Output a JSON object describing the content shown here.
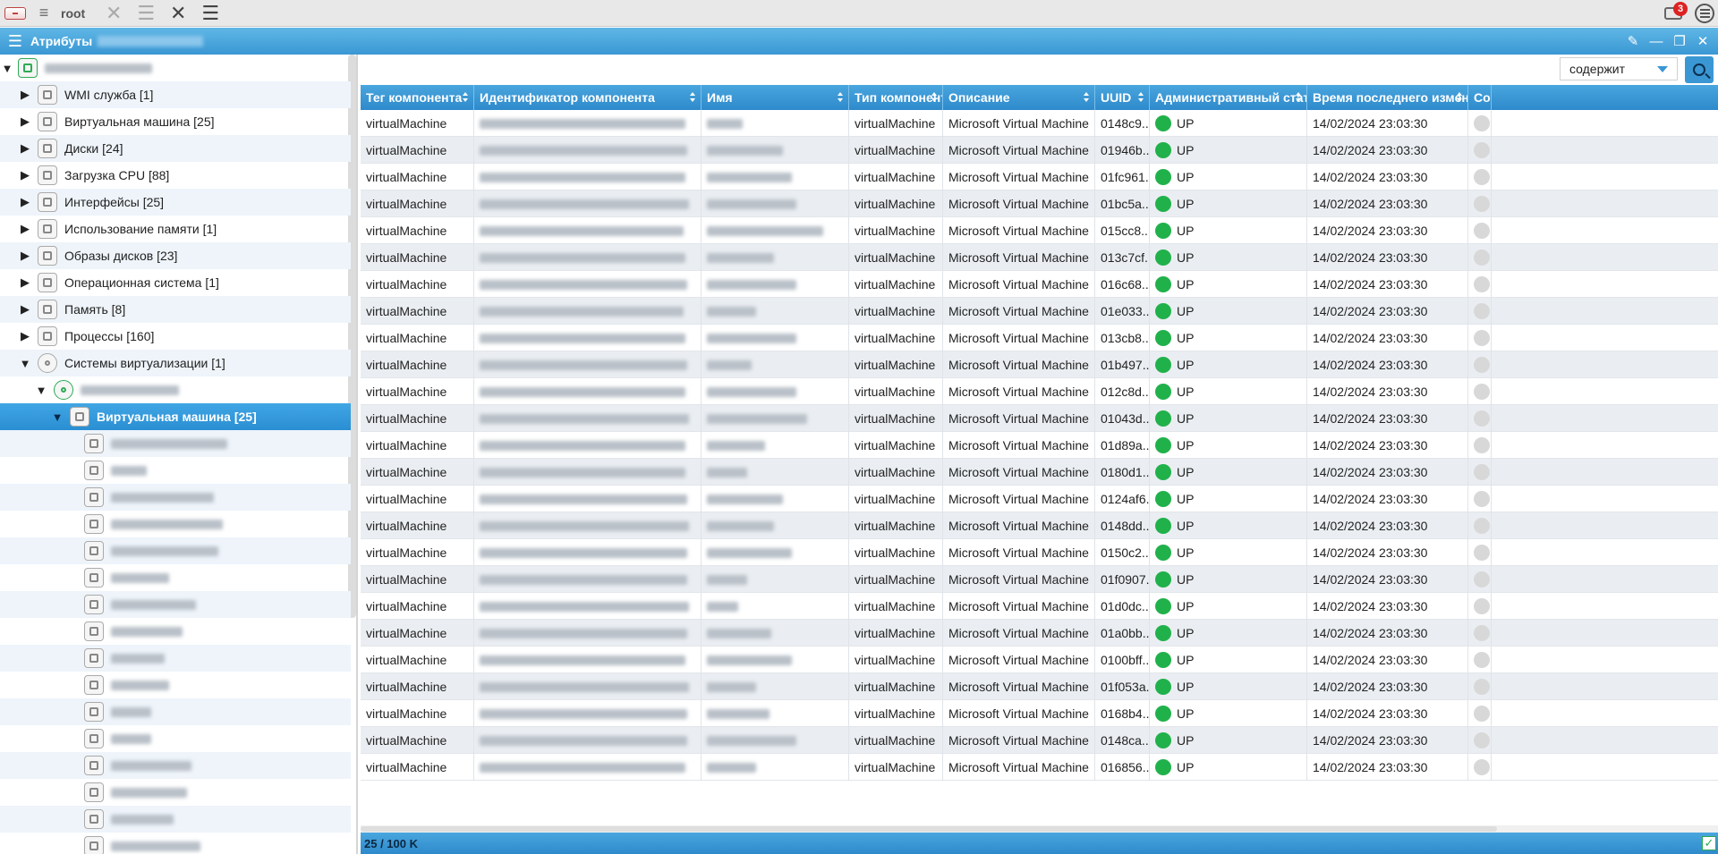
{
  "topbar": {
    "user": "root",
    "notifications_count": "3"
  },
  "window": {
    "title": "Атрибуты"
  },
  "tree": {
    "items": [
      {
        "label": "WMI служба [1]",
        "icon": "gear-icon"
      },
      {
        "label": "Виртуальная машина [25]",
        "icon": "vm-icon"
      },
      {
        "label": "Диски [24]",
        "icon": "disk-icon"
      },
      {
        "label": "Загрузка CPU [88]",
        "icon": "cpu-icon"
      },
      {
        "label": "Интерфейсы [25]",
        "icon": "network-icon"
      },
      {
        "label": "Использование памяти [1]",
        "icon": "memory-icon"
      },
      {
        "label": "Образы дисков [23]",
        "icon": "disk-image-icon"
      },
      {
        "label": "Операционная система [1]",
        "icon": "os-icon"
      },
      {
        "label": "Память [8]",
        "icon": "memory-chip-icon"
      },
      {
        "label": "Процессы [160]",
        "icon": "process-icon"
      },
      {
        "label": "Системы виртуализации [1]",
        "icon": "virtualization-icon"
      }
    ],
    "selected": {
      "label": "Виртуальная машина [25]",
      "icon": "vm-icon"
    }
  },
  "filter": {
    "mode": "содержит"
  },
  "grid": {
    "columns": [
      "Тег компонента",
      "Идентификатор компонента",
      "Имя",
      "Тип компонента",
      "Описание",
      "UUID",
      "Административный статус",
      "Время последнего изменения",
      "Сос"
    ],
    "rows": [
      {
        "tag": "virtualMachine",
        "type": "virtualMachine",
        "description": "Microsoft Virtual Machine",
        "uuid": "0148c9...",
        "status": "UP",
        "time": "14/02/2024 23:03:30"
      },
      {
        "tag": "virtualMachine",
        "type": "virtualMachine",
        "description": "Microsoft Virtual Machine",
        "uuid": "01946b...",
        "status": "UP",
        "time": "14/02/2024 23:03:30"
      },
      {
        "tag": "virtualMachine",
        "type": "virtualMachine",
        "description": "Microsoft Virtual Machine",
        "uuid": "01fc961...",
        "status": "UP",
        "time": "14/02/2024 23:03:30"
      },
      {
        "tag": "virtualMachine",
        "type": "virtualMachine",
        "description": "Microsoft Virtual Machine",
        "uuid": "01bc5a...",
        "status": "UP",
        "time": "14/02/2024 23:03:30"
      },
      {
        "tag": "virtualMachine",
        "type": "virtualMachine",
        "description": "Microsoft Virtual Machine",
        "uuid": "015cc8...",
        "status": "UP",
        "time": "14/02/2024 23:03:30"
      },
      {
        "tag": "virtualMachine",
        "type": "virtualMachine",
        "description": "Microsoft Virtual Machine",
        "uuid": "013c7cf...",
        "status": "UP",
        "time": "14/02/2024 23:03:30"
      },
      {
        "tag": "virtualMachine",
        "type": "virtualMachine",
        "description": "Microsoft Virtual Machine",
        "uuid": "016c68...",
        "status": "UP",
        "time": "14/02/2024 23:03:30"
      },
      {
        "tag": "virtualMachine",
        "type": "virtualMachine",
        "description": "Microsoft Virtual Machine",
        "uuid": "01e033...",
        "status": "UP",
        "time": "14/02/2024 23:03:30"
      },
      {
        "tag": "virtualMachine",
        "type": "virtualMachine",
        "description": "Microsoft Virtual Machine",
        "uuid": "013cb8...",
        "status": "UP",
        "time": "14/02/2024 23:03:30"
      },
      {
        "tag": "virtualMachine",
        "type": "virtualMachine",
        "description": "Microsoft Virtual Machine",
        "uuid": "01b497...",
        "status": "UP",
        "time": "14/02/2024 23:03:30"
      },
      {
        "tag": "virtualMachine",
        "type": "virtualMachine",
        "description": "Microsoft Virtual Machine",
        "uuid": "012c8d...",
        "status": "UP",
        "time": "14/02/2024 23:03:30"
      },
      {
        "tag": "virtualMachine",
        "type": "virtualMachine",
        "description": "Microsoft Virtual Machine",
        "uuid": "01043d...",
        "status": "UP",
        "time": "14/02/2024 23:03:30"
      },
      {
        "tag": "virtualMachine",
        "type": "virtualMachine",
        "description": "Microsoft Virtual Machine",
        "uuid": "01d89a...",
        "status": "UP",
        "time": "14/02/2024 23:03:30"
      },
      {
        "tag": "virtualMachine",
        "type": "virtualMachine",
        "description": "Microsoft Virtual Machine",
        "uuid": "0180d1...",
        "status": "UP",
        "time": "14/02/2024 23:03:30"
      },
      {
        "tag": "virtualMachine",
        "type": "virtualMachine",
        "description": "Microsoft Virtual Machine",
        "uuid": "0124af6...",
        "status": "UP",
        "time": "14/02/2024 23:03:30"
      },
      {
        "tag": "virtualMachine",
        "type": "virtualMachine",
        "description": "Microsoft Virtual Machine",
        "uuid": "0148dd...",
        "status": "UP",
        "time": "14/02/2024 23:03:30"
      },
      {
        "tag": "virtualMachine",
        "type": "virtualMachine",
        "description": "Microsoft Virtual Machine",
        "uuid": "0150c2...",
        "status": "UP",
        "time": "14/02/2024 23:03:30"
      },
      {
        "tag": "virtualMachine",
        "type": "virtualMachine",
        "description": "Microsoft Virtual Machine",
        "uuid": "01f0907...",
        "status": "UP",
        "time": "14/02/2024 23:03:30"
      },
      {
        "tag": "virtualMachine",
        "type": "virtualMachine",
        "description": "Microsoft Virtual Machine",
        "uuid": "01d0dc...",
        "status": "UP",
        "time": "14/02/2024 23:03:30"
      },
      {
        "tag": "virtualMachine",
        "type": "virtualMachine",
        "description": "Microsoft Virtual Machine",
        "uuid": "01a0bb...",
        "status": "UP",
        "time": "14/02/2024 23:03:30"
      },
      {
        "tag": "virtualMachine",
        "type": "virtualMachine",
        "description": "Microsoft Virtual Machine",
        "uuid": "0100bff...",
        "status": "UP",
        "time": "14/02/2024 23:03:30"
      },
      {
        "tag": "virtualMachine",
        "type": "virtualMachine",
        "description": "Microsoft Virtual Machine",
        "uuid": "01f053a...",
        "status": "UP",
        "time": "14/02/2024 23:03:30"
      },
      {
        "tag": "virtualMachine",
        "type": "virtualMachine",
        "description": "Microsoft Virtual Machine",
        "uuid": "0168b4...",
        "status": "UP",
        "time": "14/02/2024 23:03:30"
      },
      {
        "tag": "virtualMachine",
        "type": "virtualMachine",
        "description": "Microsoft Virtual Machine",
        "uuid": "0148ca...",
        "status": "UP",
        "time": "14/02/2024 23:03:30"
      },
      {
        "tag": "virtualMachine",
        "type": "virtualMachine",
        "description": "Microsoft Virtual Machine",
        "uuid": "016856...",
        "status": "UP",
        "time": "14/02/2024 23:03:30"
      }
    ],
    "status_color": "#21b14b"
  },
  "footer": {
    "count": "25 / 100 K"
  }
}
